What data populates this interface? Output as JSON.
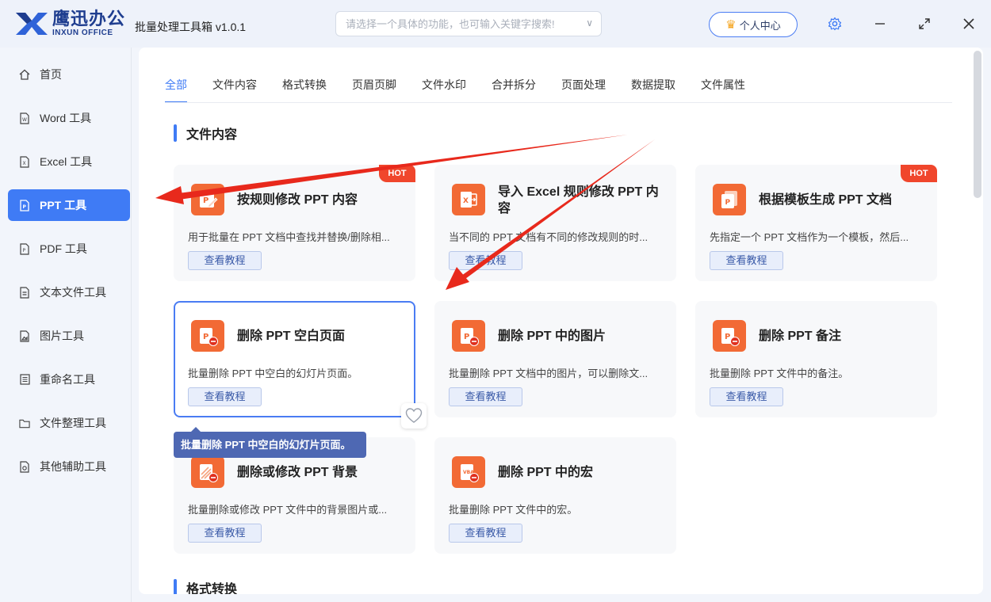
{
  "app": {
    "logo_cn": "鹰迅办公",
    "logo_en": "INXUN OFFICE",
    "title": "批量处理工具箱 v1.0.1",
    "search_placeholder": "请选择一个具体的功能，也可输入关键字搜索!",
    "user_center": "个人中心"
  },
  "sidebar": {
    "items": [
      {
        "label": "首页",
        "icon": "home-icon"
      },
      {
        "label": "Word 工具",
        "icon": "word-file-icon"
      },
      {
        "label": "Excel 工具",
        "icon": "excel-file-icon"
      },
      {
        "label": "PPT 工具",
        "icon": "ppt-file-icon",
        "active": true
      },
      {
        "label": "PDF 工具",
        "icon": "pdf-file-icon"
      },
      {
        "label": "文本文件工具",
        "icon": "text-file-icon"
      },
      {
        "label": "图片工具",
        "icon": "image-file-icon"
      },
      {
        "label": "重命名工具",
        "icon": "rename-icon"
      },
      {
        "label": "文件整理工具",
        "icon": "folder-icon"
      },
      {
        "label": "其他辅助工具",
        "icon": "misc-tools-icon"
      }
    ]
  },
  "tabs": [
    "全部",
    "文件内容",
    "格式转换",
    "页眉页脚",
    "文件水印",
    "合并拆分",
    "页面处理",
    "数据提取",
    "文件属性"
  ],
  "sections": {
    "file_content": "文件内容",
    "format_conversion": "格式转换"
  },
  "cards": [
    {
      "title": "按规则修改 PPT 内容",
      "desc": "用于批量在 PPT 文档中查找并替换/删除相...",
      "tutorial": "查看教程",
      "badge": "HOT",
      "icon": "ppt-edit-icon"
    },
    {
      "title": "导入 Excel 规则修改 PPT 内容",
      "desc": "当不同的 PPT 文档有不同的修改规则的时...",
      "tutorial": "查看教程",
      "icon": "excel-import-icon"
    },
    {
      "title": "根据模板生成 PPT 文档",
      "desc": "先指定一个 PPT 文档作为一个模板，然后...",
      "tutorial": "查看教程",
      "badge": "HOT",
      "icon": "ppt-template-icon"
    },
    {
      "title": "删除 PPT 空白页面",
      "desc": "批量删除 PPT 中空白的幻灯片页面。",
      "tutorial": "查看教程",
      "icon": "ppt-delete-icon"
    },
    {
      "title": "删除 PPT 中的图片",
      "desc": "批量删除 PPT 文档中的图片，可以删除文...",
      "tutorial": "查看教程",
      "icon": "ppt-delete-image-icon"
    },
    {
      "title": "删除 PPT 备注",
      "desc": "批量删除 PPT 文件中的备注。",
      "tutorial": "查看教程",
      "icon": "ppt-delete-notes-icon"
    },
    {
      "title": "删除或修改 PPT 背景",
      "desc": "批量删除或修改 PPT 文件中的背景图片或...",
      "tutorial": "查看教程",
      "icon": "ppt-background-icon"
    },
    {
      "title": "删除 PPT 中的宏",
      "desc": "批量删除 PPT 文件中的宏。",
      "tutorial": "查看教程",
      "icon": "ppt-delete-macro-icon"
    }
  ],
  "tooltip": "批量删除 PPT 中空白的幻灯片页面。",
  "colors": {
    "accent": "#3f7bf5",
    "card_icon": "#f26a35",
    "hot_badge": "#f0462c",
    "annotation_arrow": "#e8291c"
  }
}
